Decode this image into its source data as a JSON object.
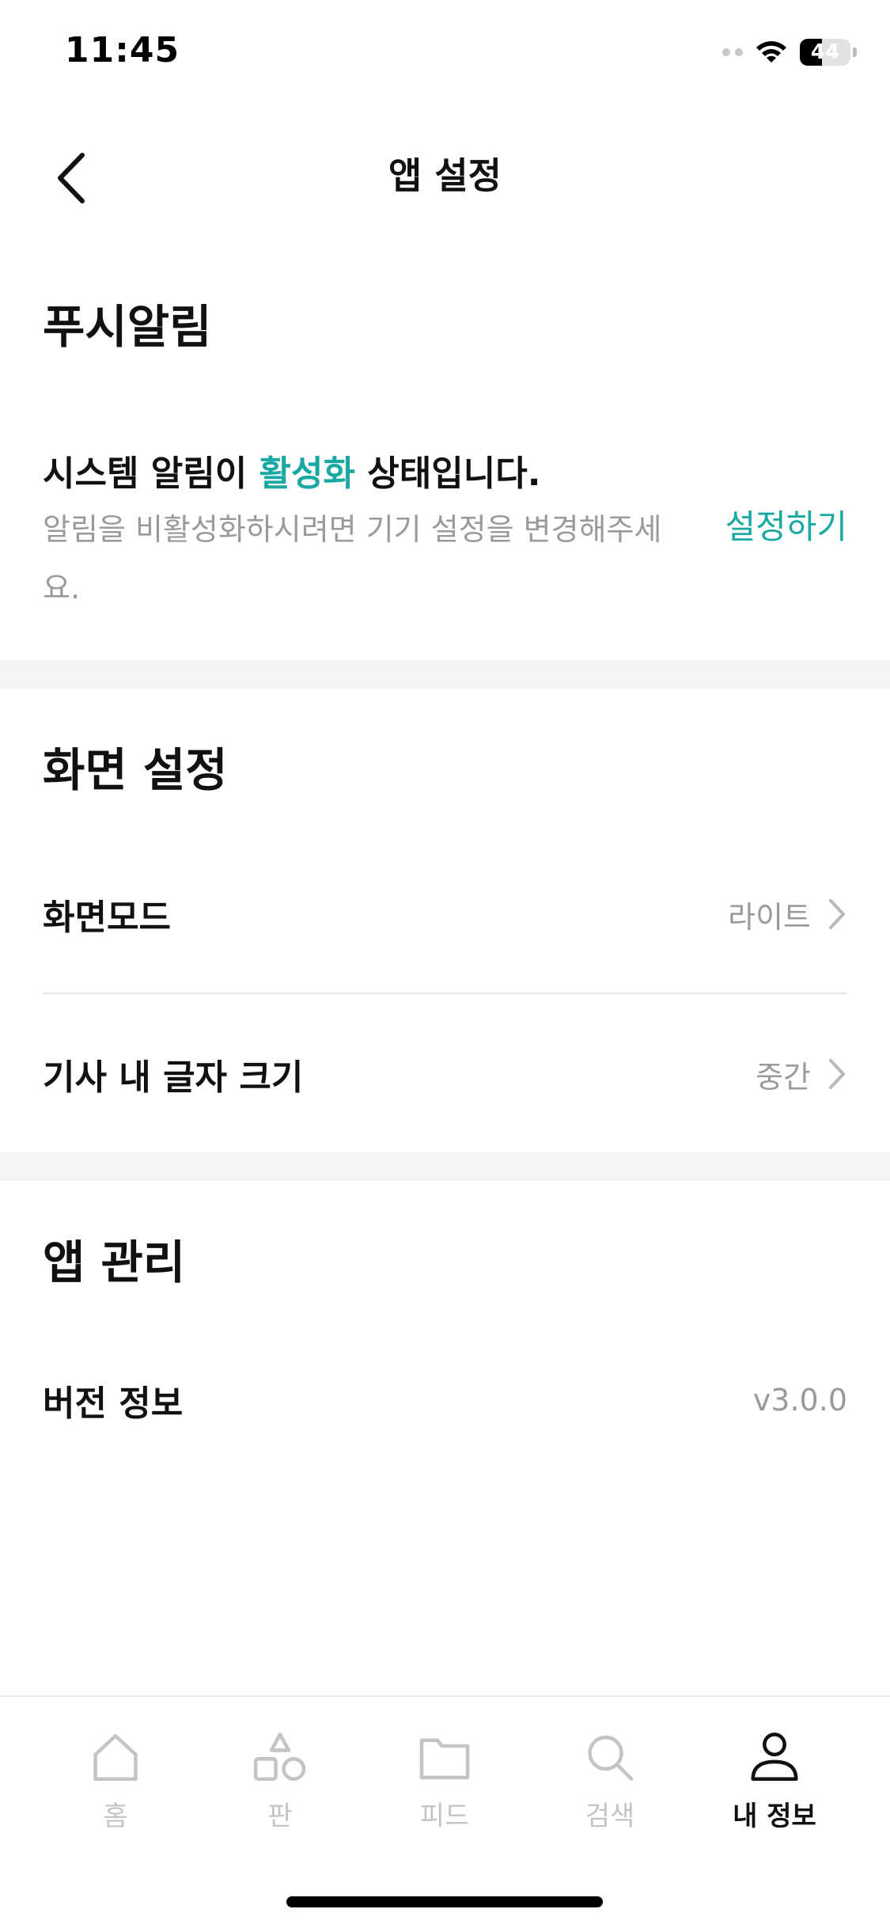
{
  "status_bar": {
    "time": "11:45",
    "battery_level": "44",
    "battery_fraction": 0.44
  },
  "header": {
    "back_icon": "chevron-left-icon",
    "title": "앱 설정"
  },
  "push_section": {
    "title": "푸시알림",
    "status_prefix": "시스템 알림이 ",
    "status_accent": "활성화",
    "status_suffix": " 상태입니다.",
    "description": "알림을 비활성화하시려면 기기 설정을 변경해주세요.",
    "action_label": "설정하기"
  },
  "display_section": {
    "title": "화면 설정",
    "rows": [
      {
        "label": "화면모드",
        "value": "라이트"
      },
      {
        "label": "기사 내 글자 크기",
        "value": "중간"
      }
    ]
  },
  "app_section": {
    "title": "앱 관리",
    "rows": [
      {
        "label": "버전 정보",
        "value": "v3.0.0"
      }
    ]
  },
  "tabbar": {
    "items": [
      {
        "label": "홈",
        "icon": "home-icon",
        "active": false
      },
      {
        "label": "판",
        "icon": "shapes-icon",
        "active": false
      },
      {
        "label": "피드",
        "icon": "folder-icon",
        "active": false
      },
      {
        "label": "검색",
        "icon": "search-icon",
        "active": false
      },
      {
        "label": "내 정보",
        "icon": "person-icon",
        "active": true
      }
    ]
  },
  "colors": {
    "accent": "#19a9a2",
    "text_primary": "#111111",
    "text_secondary": "#9a9a9a",
    "tab_inactive": "#c4c4c4",
    "section_band": "#f5f5f5"
  }
}
